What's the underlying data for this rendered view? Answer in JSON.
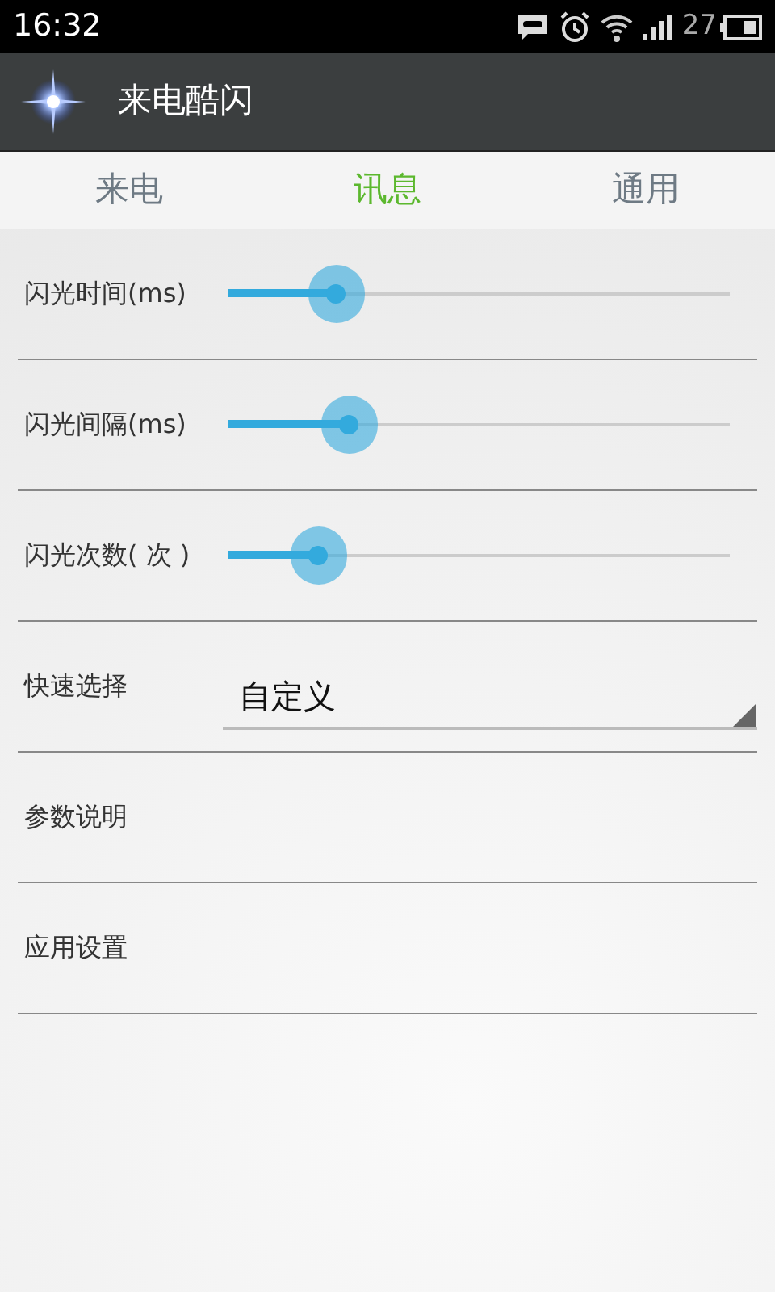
{
  "status_bar": {
    "time": "16:32",
    "battery_text": "27"
  },
  "action_bar": {
    "title": "来电酷闪"
  },
  "tabs": [
    {
      "label": "来电",
      "selected": false
    },
    {
      "label": "讯息",
      "selected": true
    },
    {
      "label": "通用",
      "selected": false
    }
  ],
  "settings": [
    {
      "kind": "slider",
      "label": "闪光时间(ms)",
      "level": 0.215
    },
    {
      "kind": "slider",
      "label": "闪光间隔(ms)",
      "level": 0.24
    },
    {
      "kind": "slider",
      "label": "闪光次数( 次 )",
      "level": 0.18
    },
    {
      "kind": "spinner",
      "label": "快速选择",
      "value": "自定义"
    },
    {
      "kind": "plain",
      "label": "参数说明"
    },
    {
      "kind": "plain",
      "label": "应用设置"
    }
  ]
}
